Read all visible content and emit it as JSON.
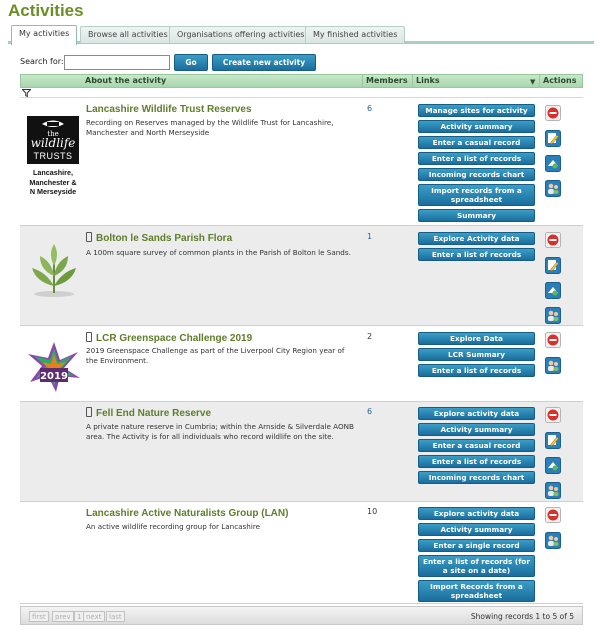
{
  "page": {
    "title": "Activities"
  },
  "tabs": [
    "My activities",
    "Browse all activities",
    "Organisations offering activities",
    "My finished activities"
  ],
  "search": {
    "label": "Search for:",
    "value": "",
    "go_label": "Go",
    "create_label": "Create new activity"
  },
  "table": {
    "headers": {
      "about": "About the activity",
      "members": "Members",
      "links": "Links",
      "actions": "Actions"
    }
  },
  "rows": [
    {
      "title": "Lancashire Wildlife Trust Reserves",
      "desc": "Recording on Reserves managed by the Wildlife Trust for Lancashire, Manchester and North Merseyside",
      "members": "6",
      "logo_text": [
        "the",
        "wildlife",
        "TRUSTS"
      ],
      "logo_caption": [
        "Lancashire,",
        "Manchester &",
        "N Merseyside"
      ],
      "links": [
        "Manage sites for activity",
        "Activity summary",
        "Enter a casual record",
        "Enter a list of records",
        "Incoming records chart",
        "Import records from a spreadsheet",
        "Summary"
      ]
    },
    {
      "title": "Bolton le Sands Parish Flora",
      "desc": "A 100m square survey of common plants in the Parish of Bolton le Sands.",
      "members": "1",
      "links": [
        "Explore Activity data",
        "Enter a list of records"
      ]
    },
    {
      "title": "LCR Greenspace Challenge 2019",
      "desc": "2019 Greenspace Challenge as part of the Liverpool City Region year of the Environment.",
      "members": "2",
      "logo_year": "2019",
      "links": [
        "Explore Data",
        "LCR Summary",
        "Enter a list of records"
      ]
    },
    {
      "title": "Fell End Nature Reserve",
      "desc": "A private nature reserve in Cumbria; within the Arnside & Silverdale AONB area. The Activity is for all individuals who record wildlife on the site.",
      "members": "6",
      "links": [
        "Explore activity data",
        "Activity summary",
        "Enter a casual record",
        "Enter a list of records",
        "Incoming records chart"
      ]
    },
    {
      "title": "Lancashire Active Naturalists Group (LAN)",
      "desc": "An active wildlife recording group for Lancashire",
      "members": "10",
      "links": [
        "Explore activity data",
        "Activity summary",
        "Enter a single record",
        "Enter a list of records (for a site on a date)",
        "Import Records from a spreadsheet"
      ]
    }
  ],
  "pager": {
    "first": "first",
    "prev": "prev",
    "page": "1",
    "next": "next",
    "last": "last",
    "showing": "Showing records 1 to 5 of 5"
  },
  "colors": {
    "title_green": "#6b8e23",
    "button_blue": "#1b6d9c",
    "header_green": "#a9d6ae",
    "delete_red": "#d9302c"
  }
}
